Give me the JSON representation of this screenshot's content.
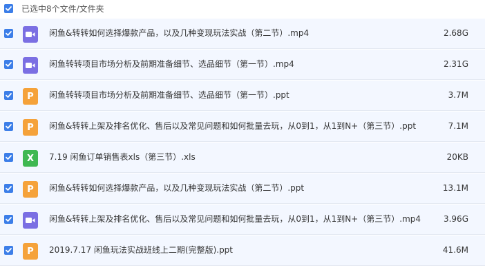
{
  "header": {
    "selection_text": "已选中8个文件/文件夹"
  },
  "colors": {
    "checkbox": "#3c7ee8",
    "video_icon": "#7b6fe3",
    "ppt_icon": "#f5a23a",
    "xls_icon": "#3fb851",
    "row_background": "#f3f7ff"
  },
  "files": [
    {
      "name": "闲鱼&转转如何选择爆款产品，以及几种变现玩法实战（第二节）.mp4",
      "size": "2.68G",
      "icon": "video-icon",
      "icon_glyph": ""
    },
    {
      "name": "闲鱼转转项目市场分析及前期准备细节、选品细节（第一节）.mp4",
      "size": "2.31G",
      "icon": "video-icon",
      "icon_glyph": ""
    },
    {
      "name": "闲鱼转转项目市场分析及前期准备细节、选品细节（第一节）.ppt",
      "size": "3.7M",
      "icon": "ppt-icon",
      "icon_glyph": "P"
    },
    {
      "name": "闲鱼&转转上架及排名优化、售后以及常见问题和如何批量去玩，从0到1，从1到N+（第三节）.ppt",
      "size": "7.1M",
      "icon": "ppt-icon",
      "icon_glyph": "P"
    },
    {
      "name": "7.19 闲鱼订单销售表xls（第三节）.xls",
      "size": "20KB",
      "icon": "xls-icon",
      "icon_glyph": "X"
    },
    {
      "name": "闲鱼&转转如何选择爆款产品，以及几种变现玩法实战（第二节）.ppt",
      "size": "13.1M",
      "icon": "ppt-icon",
      "icon_glyph": "P"
    },
    {
      "name": "闲鱼&转转上架及排名优化、售后以及常见问题和如何批量去玩，从0到1，从1到N+（第三节）.mp4",
      "size": "3.96G",
      "icon": "video-icon",
      "icon_glyph": ""
    },
    {
      "name": "2019.7.17 闲鱼玩法实战班线上二期(完整版).ppt",
      "size": "41.6M",
      "icon": "ppt-icon",
      "icon_glyph": "P"
    }
  ]
}
